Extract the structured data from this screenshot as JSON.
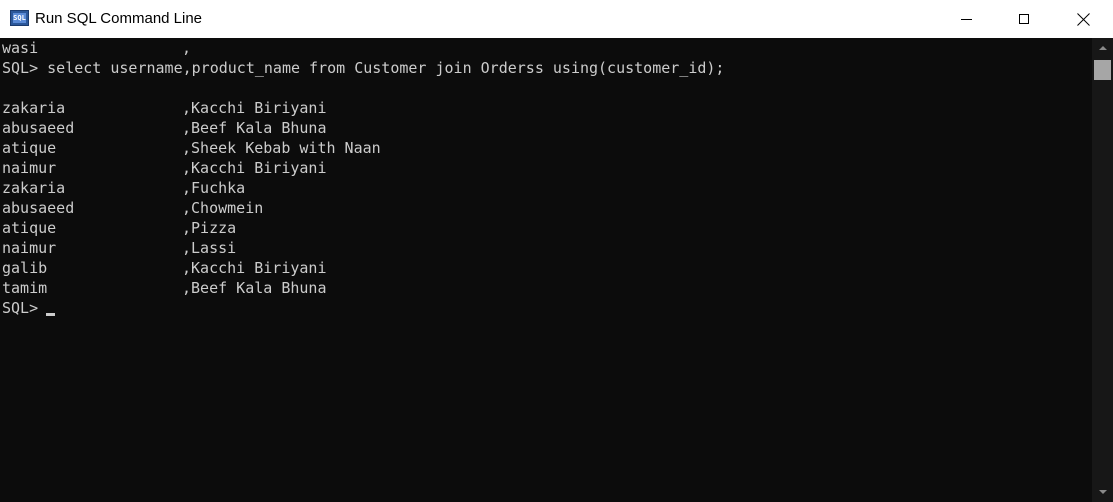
{
  "window": {
    "title": "Run SQL Command Line",
    "icon_label": "SQL",
    "icon": "sqlplus-app-icon",
    "controls": {
      "minimize_icon": "minimize-icon",
      "maximize_icon": "maximize-icon",
      "close_icon": "close-icon"
    }
  },
  "console": {
    "previous_row": {
      "c1": "wasi",
      "c2": ","
    },
    "command_line": "SQL> select username,product_name from Customer join Orderss using(customer_id);",
    "rows": [
      {
        "c1": "zakaria",
        "c2": ",Kacchi Biriyani"
      },
      {
        "c1": "abusaeed",
        "c2": ",Beef Kala Bhuna"
      },
      {
        "c1": "atique",
        "c2": ",Sheek Kebab with Naan"
      },
      {
        "c1": "naimur",
        "c2": ",Kacchi Biriyani"
      },
      {
        "c1": "zakaria",
        "c2": ",Fuchka"
      },
      {
        "c1": "abusaeed",
        "c2": ",Chowmein"
      },
      {
        "c1": "atique",
        "c2": ",Pizza"
      },
      {
        "c1": "naimur",
        "c2": ",Lassi"
      },
      {
        "c1": "galib",
        "c2": ",Kacchi Biriyani"
      },
      {
        "c1": "tamim",
        "c2": ",Beef Kala Bhuna"
      }
    ],
    "prompt": "SQL> ",
    "colors": {
      "background": "#0c0c0c",
      "text": "#cccccc"
    }
  }
}
